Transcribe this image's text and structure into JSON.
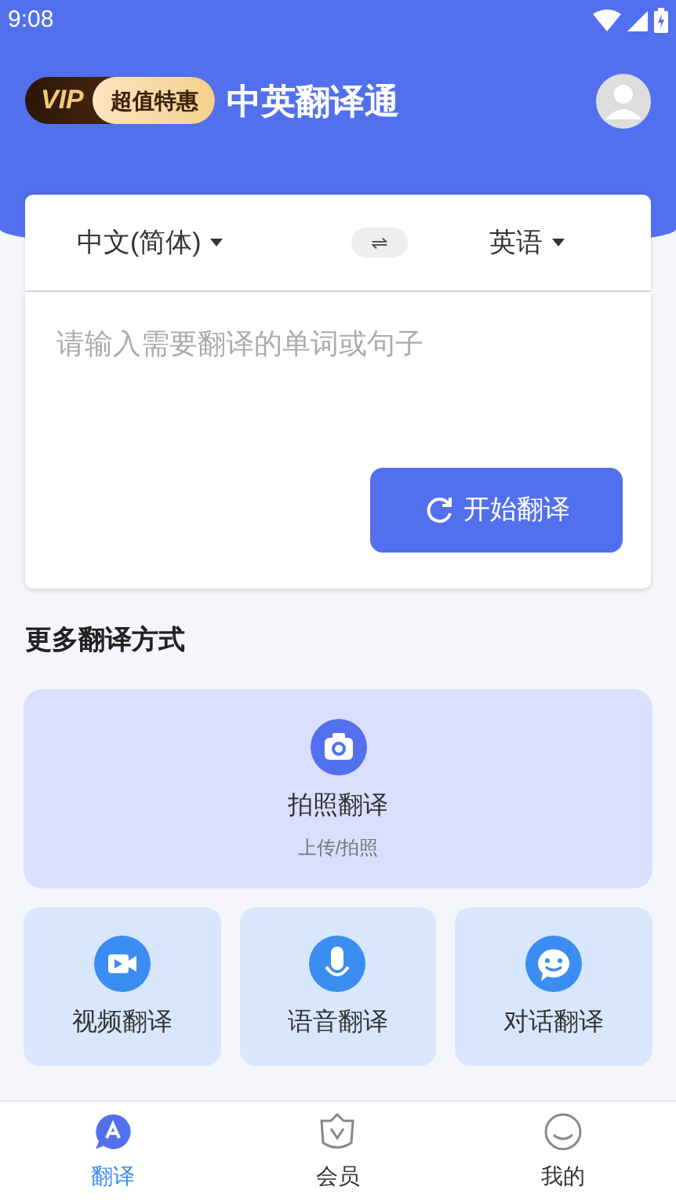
{
  "status_bar": {
    "time": "9:08"
  },
  "header": {
    "vip_label": "VIP",
    "promo": "超值特惠",
    "title": "中英翻译通"
  },
  "translator": {
    "source_language": "中文(简体)",
    "swap": "⇌",
    "target_language": "英语",
    "placeholder": "请输入需要翻译的单词或句子",
    "action": "开始翻译"
  },
  "more": {
    "heading": "更多翻译方式",
    "featured": {
      "kind": "camera",
      "label": "拍照翻译",
      "caption": "上传/拍照"
    },
    "modes": [
      {
        "kind": "video",
        "label": "视频翻译"
      },
      {
        "kind": "mic",
        "label": "语音翻译"
      },
      {
        "kind": "chat",
        "label": "对话翻译"
      }
    ]
  },
  "tabs": [
    {
      "kind": "translate",
      "label": "翻译",
      "selected": true
    },
    {
      "kind": "member",
      "label": "会员",
      "selected": false
    },
    {
      "kind": "me",
      "label": "我的",
      "selected": false
    }
  ]
}
